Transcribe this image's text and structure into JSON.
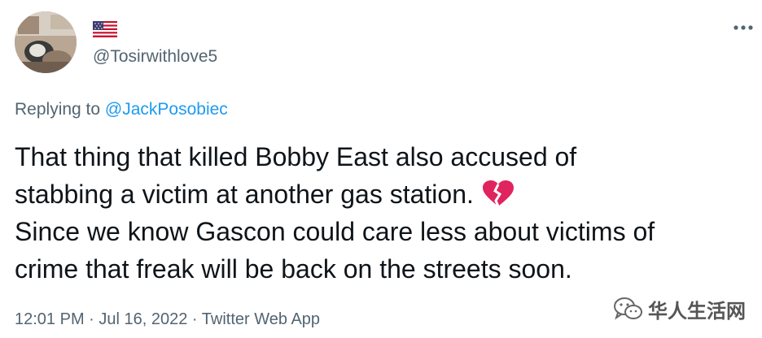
{
  "author": {
    "handle": "@Tosirwithlove5",
    "flag_icon": "us-flag-icon"
  },
  "reply": {
    "prefix": "Replying to ",
    "mention": "@JackPosobiec"
  },
  "tweet": {
    "line_1": "That thing that killed Bobby East also accused of",
    "line_2": "stabbing a victim at another gas station.",
    "line_2_emoji": "broken-heart-icon",
    "line_3": "Since we know Gascon could care less about victims of",
    "line_4": "crime  that freak will be back on the streets soon."
  },
  "meta": {
    "time": "12:01 PM",
    "separator": " · ",
    "date": "Jul 16, 2022",
    "source": "Twitter Web App"
  },
  "watermark": {
    "text": "华人生活网"
  },
  "colors": {
    "text": "#0f1419",
    "secondary": "#536471",
    "link": "#1d9bf0",
    "heart": "#e0245e"
  }
}
